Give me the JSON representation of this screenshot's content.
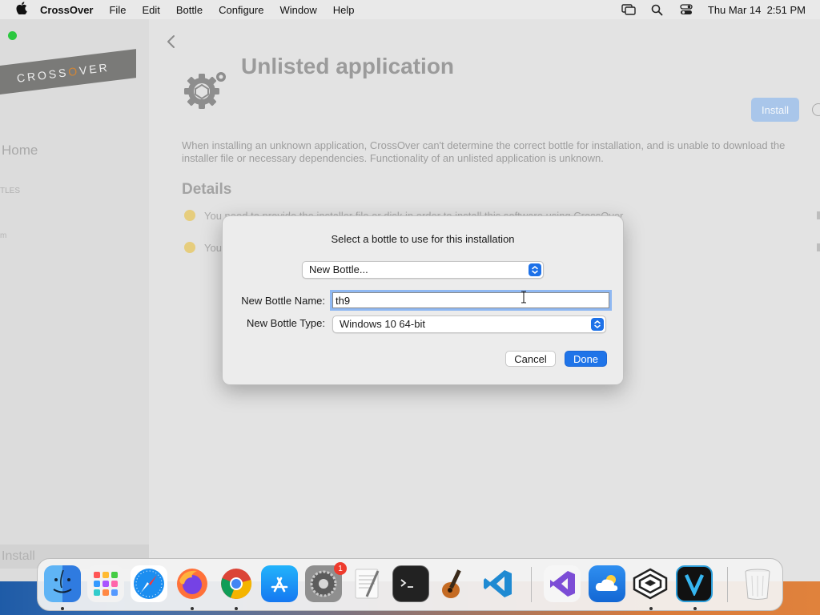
{
  "menubar": {
    "app_name": "CrossOver",
    "items": [
      "File",
      "Edit",
      "Bottle",
      "Configure",
      "Window",
      "Help"
    ],
    "clock": "Thu Mar 14  2:51 PM"
  },
  "sidebar": {
    "logo": "CROSSOVER",
    "home": "Home",
    "bottles_fragment": "TLES",
    "item_fragment": "m",
    "install_label": "Install"
  },
  "main": {
    "title": "Unlisted application",
    "install_button": "Install",
    "description": "When installing an unknown application, CrossOver can't determine the correct bottle for installation, and is unable to download the installer file or necessary dependencies. Functionality of an unlisted application is unknown.",
    "details_heading": "Details",
    "detail_1": "You need to provide the installer file or disk in order to install this software using CrossOver",
    "detail_2": "You"
  },
  "dialog": {
    "title": "Select a bottle to use for this installation",
    "bottle_select_value": "New Bottle...",
    "name_label": "New Bottle Name:",
    "name_value": "th9",
    "type_label": "New Bottle Type:",
    "type_value": "Windows 10 64-bit",
    "cancel_label": "Cancel",
    "done_label": "Done"
  },
  "dock": {
    "apps": [
      "finder-icon",
      "launchpad-icon",
      "safari-icon",
      "firefox-icon",
      "chrome-icon",
      "app-store-icon",
      "system-settings-icon",
      "textedit-icon",
      "terminal-icon",
      "garageband-icon",
      "vscode-icon",
      "visual-studio-icon",
      "cloud-app-icon",
      "crossover-icon",
      "v-app-icon",
      "trash-icon"
    ],
    "settings_badge": "1"
  },
  "colors": {
    "accent": "#1f74e8",
    "install_disabled": "#a9c6ea",
    "traffic_green": "#2cc840",
    "warning_dot": "#e6cd7d"
  }
}
